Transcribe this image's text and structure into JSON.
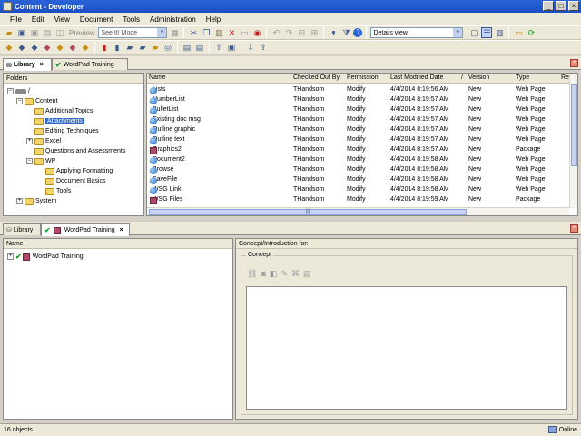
{
  "window": {
    "title": "Content - Developer"
  },
  "menu": [
    "File",
    "Edit",
    "View",
    "Document",
    "Tools",
    "Administration",
    "Help"
  ],
  "toolbar": {
    "preview_label": "Preview",
    "mode_select": "See It! Mode",
    "view_select": "Details view"
  },
  "library_tabs": [
    {
      "label": "Library"
    },
    {
      "label": "WordPad Training"
    }
  ],
  "folders_panel": {
    "header": "Folders",
    "tree": [
      {
        "label": "/"
      },
      {
        "label": "Content"
      },
      {
        "label": "Additional Topics"
      },
      {
        "label": "Attachments"
      },
      {
        "label": "Editing Techniques"
      },
      {
        "label": "Excel"
      },
      {
        "label": "Questions and Assessments"
      },
      {
        "label": "WP"
      },
      {
        "label": "Applying Formatting"
      },
      {
        "label": "Document Basics"
      },
      {
        "label": "Tools"
      },
      {
        "label": "System"
      }
    ]
  },
  "list_panel": {
    "columns": [
      "Name",
      "Checked Out By",
      "Permission",
      "Last Modified Date",
      "/",
      "Version",
      "Type",
      "Re"
    ],
    "rows": [
      {
        "name": "Lists",
        "checked_out_by": "THandsom",
        "permission": "Modify",
        "modified": "4/4/2014 8:19:56 AM",
        "version": "New",
        "type": "Web Page",
        "icon": "globe"
      },
      {
        "name": "NumberList",
        "checked_out_by": "THandsom",
        "permission": "Modify",
        "modified": "4/4/2014 8:19:57 AM",
        "version": "New",
        "type": "Web Page",
        "icon": "globe"
      },
      {
        "name": "BulletList",
        "checked_out_by": "THandsom",
        "permission": "Modify",
        "modified": "4/4/2014 8:19:57 AM",
        "version": "New",
        "type": "Web Page",
        "icon": "globe"
      },
      {
        "name": "Existing doc msg",
        "checked_out_by": "THandsom",
        "permission": "Modify",
        "modified": "4/4/2014 8:19:57 AM",
        "version": "New",
        "type": "Web Page",
        "icon": "globe"
      },
      {
        "name": "Outline graphic",
        "checked_out_by": "THandsom",
        "permission": "Modify",
        "modified": "4/4/2014 8:19:57 AM",
        "version": "New",
        "type": "Web Page",
        "icon": "globe"
      },
      {
        "name": "Outline text",
        "checked_out_by": "THandsom",
        "permission": "Modify",
        "modified": "4/4/2014 8:19:57 AM",
        "version": "New",
        "type": "Web Page",
        "icon": "globe"
      },
      {
        "name": "Graphics2",
        "checked_out_by": "THandsom",
        "permission": "Modify",
        "modified": "4/4/2014 8:19:57 AM",
        "version": "New",
        "type": "Package",
        "icon": "package"
      },
      {
        "name": "Document2",
        "checked_out_by": "THandsom",
        "permission": "Modify",
        "modified": "4/4/2014 8:19:58 AM",
        "version": "New",
        "type": "Web Page",
        "icon": "globe"
      },
      {
        "name": "Browse",
        "checked_out_by": "THandsom",
        "permission": "Modify",
        "modified": "4/4/2014 8:19:58 AM",
        "version": "New",
        "type": "Web Page",
        "icon": "globe"
      },
      {
        "name": "SaveFile",
        "checked_out_by": "THandsom",
        "permission": "Modify",
        "modified": "4/4/2014 8:19:58 AM",
        "version": "New",
        "type": "Web Page",
        "icon": "globe"
      },
      {
        "name": "WSG Link",
        "checked_out_by": "THandsom",
        "permission": "Modify",
        "modified": "4/4/2014 8:19:58 AM",
        "version": "New",
        "type": "Web Page",
        "icon": "globe"
      },
      {
        "name": "WSG Files",
        "checked_out_by": "THandsom",
        "permission": "Modify",
        "modified": "4/4/2014 8:19:59 AM",
        "version": "New",
        "type": "Package",
        "icon": "package"
      }
    ]
  },
  "outline_tabs": [
    {
      "label": "Library"
    },
    {
      "label": "WordPad Training"
    }
  ],
  "outline_panel": {
    "header": "Name",
    "root": "WordPad Training"
  },
  "concept_panel": {
    "header": "Concept/Introduction for:",
    "group_label": "Concept"
  },
  "status": {
    "objects": "16 objects",
    "connection": "Online"
  }
}
